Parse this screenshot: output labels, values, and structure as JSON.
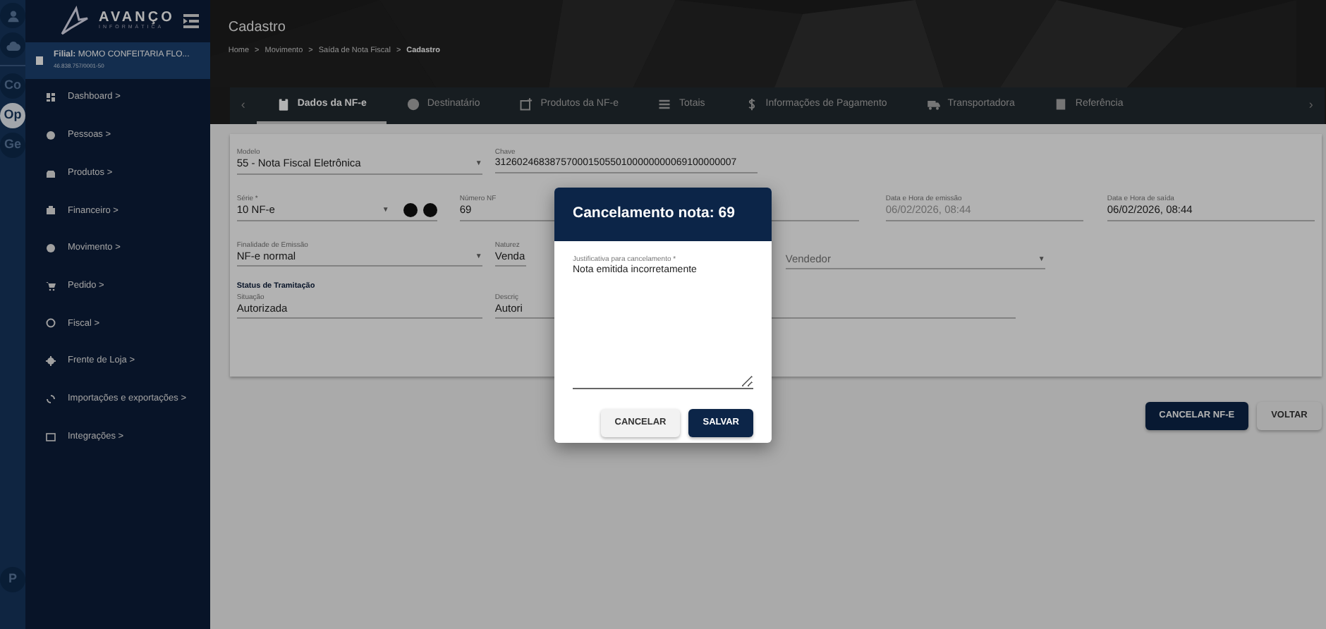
{
  "rail": [
    {
      "kind": "icon",
      "selected": false
    },
    {
      "kind": "icon",
      "selected": false
    },
    {
      "kind": "text",
      "label": "Co",
      "selected": false
    },
    {
      "kind": "text",
      "label": "Op",
      "selected": true
    },
    {
      "kind": "text",
      "label": "Ge",
      "selected": false
    }
  ],
  "rail_bottom": [
    {
      "label": "P"
    }
  ],
  "brand": {
    "name": "AVANÇO",
    "tagline": "INFORMÁTICA"
  },
  "branch": {
    "label": "Filial:",
    "name": "MOMO CONFEITARIA FLO...",
    "document": "46.838.757/0001-50"
  },
  "menu": [
    {
      "label": "Dashboard >"
    },
    {
      "label": "Pessoas >"
    },
    {
      "label": "Produtos >"
    },
    {
      "label": "Financeiro >"
    },
    {
      "label": "Movimento >"
    },
    {
      "label": "Pedido >"
    },
    {
      "label": "Fiscal >"
    },
    {
      "label": "Frente de Loja >"
    },
    {
      "label": "Importações e exportações >"
    },
    {
      "label": "Integrações >"
    }
  ],
  "page": {
    "title": "Cadastro",
    "breadcrumb": [
      {
        "label": "Home",
        "separator": ">"
      },
      {
        "label": "Movimento",
        "separator": ">"
      },
      {
        "label": "Saída de Nota Fiscal",
        "separator": ">"
      },
      {
        "label": "Cadastro"
      }
    ]
  },
  "tab_scroll": {
    "left": "‹",
    "right": "›"
  },
  "tabs": [
    {
      "label": "Dados da NF-e",
      "selected": true
    },
    {
      "label": "Destinatário",
      "selected": false
    },
    {
      "label": "Produtos da NF-e",
      "selected": false
    },
    {
      "label": "Totais",
      "selected": false
    },
    {
      "label": "Informações de Pagamento",
      "selected": false
    },
    {
      "label": "Transportadora",
      "selected": false
    },
    {
      "label": "Referência",
      "selected": false
    }
  ],
  "form_rows": [
    {
      "fields": [
        {
          "kind": "select",
          "label": "Modelo",
          "value": "55 - Nota Fiscal Eletrônica",
          "caret": "▼"
        },
        {
          "kind": "text",
          "label": "Chave",
          "value": "31260246838757000150550100000000069100000007"
        }
      ]
    },
    {
      "fields": [
        {
          "kind": "select_actions",
          "label": "Série *",
          "value": "10 NF-e",
          "caret": "▼"
        },
        {
          "kind": "text",
          "label": "Número NF",
          "value": "69"
        },
        {
          "kind": "text",
          "label": "Data e Hora de emissão",
          "value": "06/02/2026, 08:44",
          "disabled": true
        },
        {
          "kind": "text",
          "label": "Data e Hora de saída",
          "value": "06/02/2026, 08:44",
          "disabled": false
        }
      ]
    },
    {
      "fields": [
        {
          "kind": "select",
          "label": "Finalidade de Emissão",
          "value": "NF-e normal",
          "caret": "▼"
        },
        {
          "kind": "text",
          "label": "Naturez",
          "value": "Venda"
        },
        {
          "kind": "select",
          "placeholder": "Vendedor",
          "caret": "▼"
        }
      ]
    },
    {
      "heading": "Status de Tramitação",
      "fields": [
        {
          "kind": "text",
          "label": "Situação",
          "value": "Autorizada"
        },
        {
          "kind": "text",
          "label": "Descriç",
          "value": "Autori"
        }
      ]
    }
  ],
  "actions": [
    {
      "label": "CANCELAR NF-E",
      "kind": "primary"
    },
    {
      "label": "VOLTAR",
      "kind": "secondary"
    }
  ],
  "dialog": {
    "title": "Cancelamento nota: 69",
    "field_label": "Justificativa para cancelamento *",
    "value": "Nota emitida incorretamente",
    "buttons": [
      {
        "label": "CANCELAR",
        "kind": "secondary"
      },
      {
        "label": "SALVAR",
        "kind": "primary"
      }
    ]
  }
}
